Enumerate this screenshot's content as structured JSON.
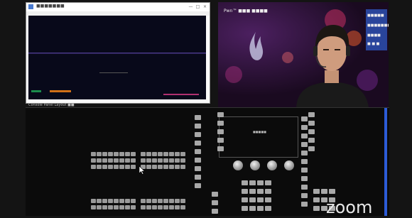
{
  "shared_screen": {
    "window_title": "■■■■■■■",
    "controls": [
      "—",
      "□",
      "×"
    ]
  },
  "camera": {
    "overlay_title": "Pwn™  ■■■  ■■■■",
    "panel_lines": [
      "■■■■■",
      "■■■■■■■",
      "■■■■",
      "■ ■ ■"
    ]
  },
  "console": {
    "window_title": "Console Panel   Layout   ■■",
    "screen_text": "■■■■■"
  },
  "zoom_brand": "zoom",
  "colors": {
    "accent_blue": "#2c5bd6",
    "progress_orange": "#d07018",
    "panel_blue": "#2b49a6"
  }
}
